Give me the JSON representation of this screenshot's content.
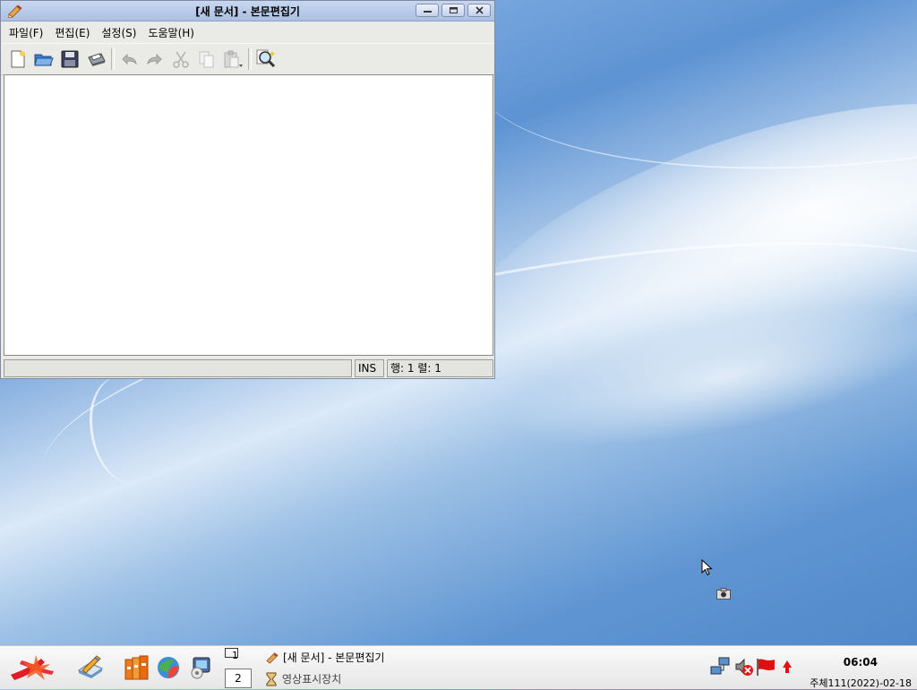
{
  "window": {
    "title": "[새 문서] - 본문편집기",
    "menu": [
      "파일(F)",
      "편집(E)",
      "설정(S)",
      "도움말(H)"
    ],
    "toolbar_icons": [
      "new-file-icon",
      "open-folder-icon",
      "save-icon",
      "print-icon",
      "undo-icon",
      "redo-icon",
      "cut-icon",
      "copy-icon",
      "paste-icon",
      "find-icon"
    ],
    "status": {
      "message": "",
      "mode": "INS",
      "position": "행: 1 렬: 1"
    }
  },
  "taskbar": {
    "pager": [
      "1",
      "2"
    ],
    "tasks": [
      {
        "label": "[새 문서] - 본문편집기",
        "icon": "editor-icon",
        "active": true
      },
      {
        "label": "영상표시장치",
        "icon": "hourglass-icon",
        "active": false
      }
    ],
    "clock": "06:04",
    "date": "주체111(2022)-02-18"
  },
  "colors": {
    "titlebar": "#b6c8ea",
    "desktop": "#5d93d3",
    "flag_red": "#e01010"
  }
}
